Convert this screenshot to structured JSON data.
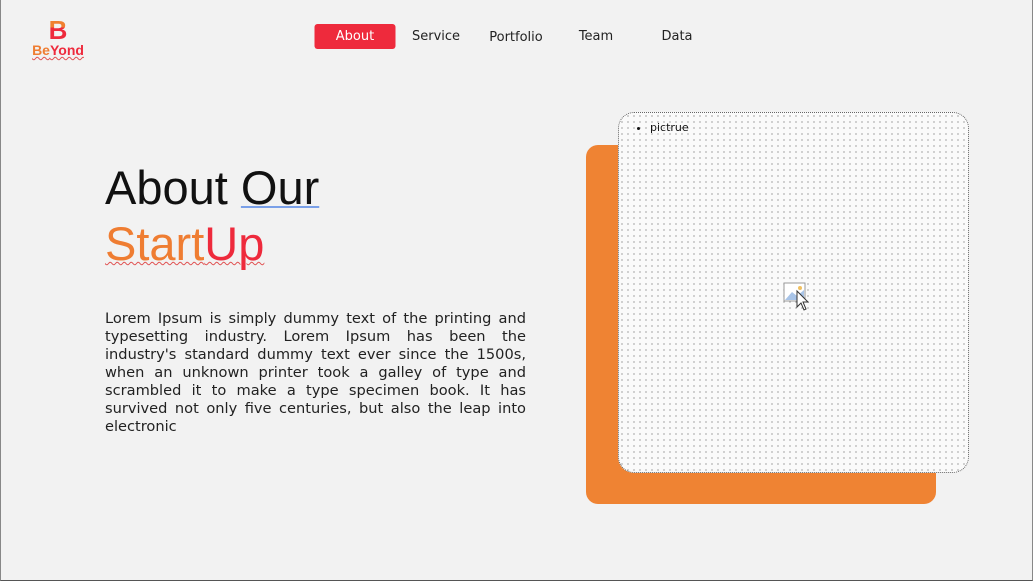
{
  "logo": {
    "letter": "B",
    "text_be": "Be",
    "text_yond": "Yond"
  },
  "nav": {
    "items": [
      {
        "label": "About",
        "active": true
      },
      {
        "label": "Service"
      },
      {
        "label": "Portfolio"
      },
      {
        "label": "Team"
      },
      {
        "label": "Data"
      }
    ]
  },
  "hero": {
    "title_line1_a": "About ",
    "title_line1_b": "Our",
    "title_line2_a": "Start",
    "title_line2_b": "Up",
    "paragraph": "Lorem Ipsum is simply dummy text of the printing and typesetting industry. Lorem Ipsum has been the industry's standard dummy text ever since the 1500s, when an unknown printer took a galley of type and scrambled it to make a type specimen book. It has survived not only five centuries, but also the leap into electronic"
  },
  "picture": {
    "caption": "pictrue",
    "icon": "image-placeholder-icon"
  },
  "colors": {
    "accent_red": "#ee2a3c",
    "accent_orange": "#ef8333"
  }
}
